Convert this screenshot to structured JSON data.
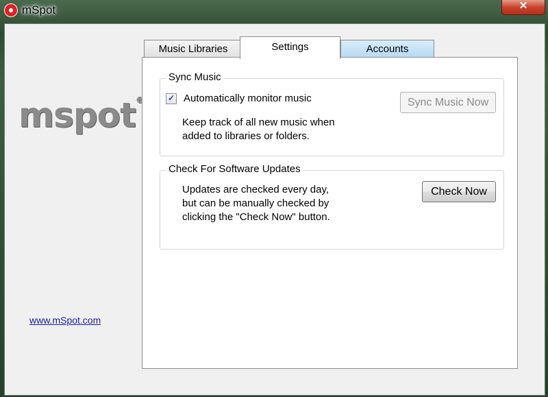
{
  "window": {
    "title": "mSpot",
    "close_symbol": "✕"
  },
  "sidebar": {
    "logo_text": "mspot",
    "logo_mark": "®",
    "link_text": "www.mSpot.com"
  },
  "tabs": [
    {
      "label": "Music Libraries"
    },
    {
      "label": "Settings"
    },
    {
      "label": "Accounts"
    }
  ],
  "sync_group": {
    "legend": "Sync Music",
    "checkbox_checked": true,
    "checkbox_label": "Automatically monitor music",
    "description": "Keep track of all new music when\nadded to libraries or folders.",
    "button_label": "Sync Music Now"
  },
  "update_group": {
    "legend": "Check For Software Updates",
    "description": "Updates are checked every day,\nbut can be manually checked by\nclicking the \"Check Now\" button.",
    "button_label": "Check Now"
  }
}
